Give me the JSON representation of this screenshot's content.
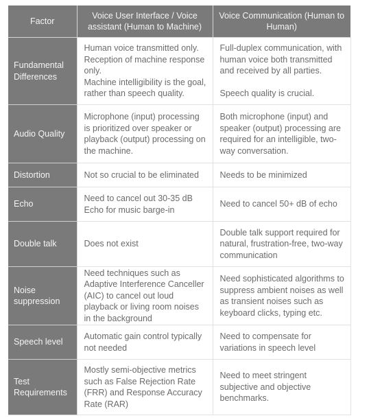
{
  "table": {
    "headers": [
      "Factor",
      "Voice User Interface / Voice assistant (Human to Machine)",
      "Voice Communication (Human to Human)"
    ],
    "rows": [
      {
        "factor": "Fundamental Differences",
        "vui": [
          "Human voice transmitted only.",
          "Reception of machine response only.",
          "Machine intelligibility is the goal, rather than speech quality."
        ],
        "comm": [
          "Full-duplex communication, with human voice both transmitted and received by all parties.",
          "",
          "Speech quality is crucial."
        ]
      },
      {
        "factor": "Audio Quality",
        "vui": [
          "Microphone (input) processing is prioritized over speaker or playback (output) processing on the machine."
        ],
        "comm": [
          "Both microphone (input) and speaker (output) processing are required for an intelligible, two-way conversation."
        ]
      },
      {
        "factor": "Distortion",
        "vui": [
          "Not so crucial to be eliminated"
        ],
        "comm": [
          "Needs to be minimized"
        ]
      },
      {
        "factor": "Echo",
        "vui": [
          "Need to cancel out 30-35 dB Echo for music barge-in"
        ],
        "comm": [
          "Need to cancel 50+ dB of echo"
        ]
      },
      {
        "factor": "Double talk",
        "vui": [
          "Does not exist"
        ],
        "comm": [
          "Double talk support required for natural, frustration-free, two-way communication"
        ]
      },
      {
        "factor": "Noise suppression",
        "vui": [
          "Need techniques such as Adaptive Interference Canceller (AIC) to cancel out loud playback or living room noises in the background"
        ],
        "comm": [
          "Need sophisticated algorithms to suppress ambient noises as well as transient noises such as keyboard clicks, typing etc."
        ]
      },
      {
        "factor": "Speech level",
        "vui": [
          "Automatic gain control typically not needed"
        ],
        "comm": [
          "Need to compensate for variations in speech level"
        ]
      },
      {
        "factor": "Test Requirements",
        "vui": [
          "Mostly semi-objective metrics such as False Rejection Rate (FRR) and Response Accuracy Rate (RAR)"
        ],
        "comm": [
          "Need to meet stringent subjective and objective benchmarks."
        ]
      }
    ]
  }
}
